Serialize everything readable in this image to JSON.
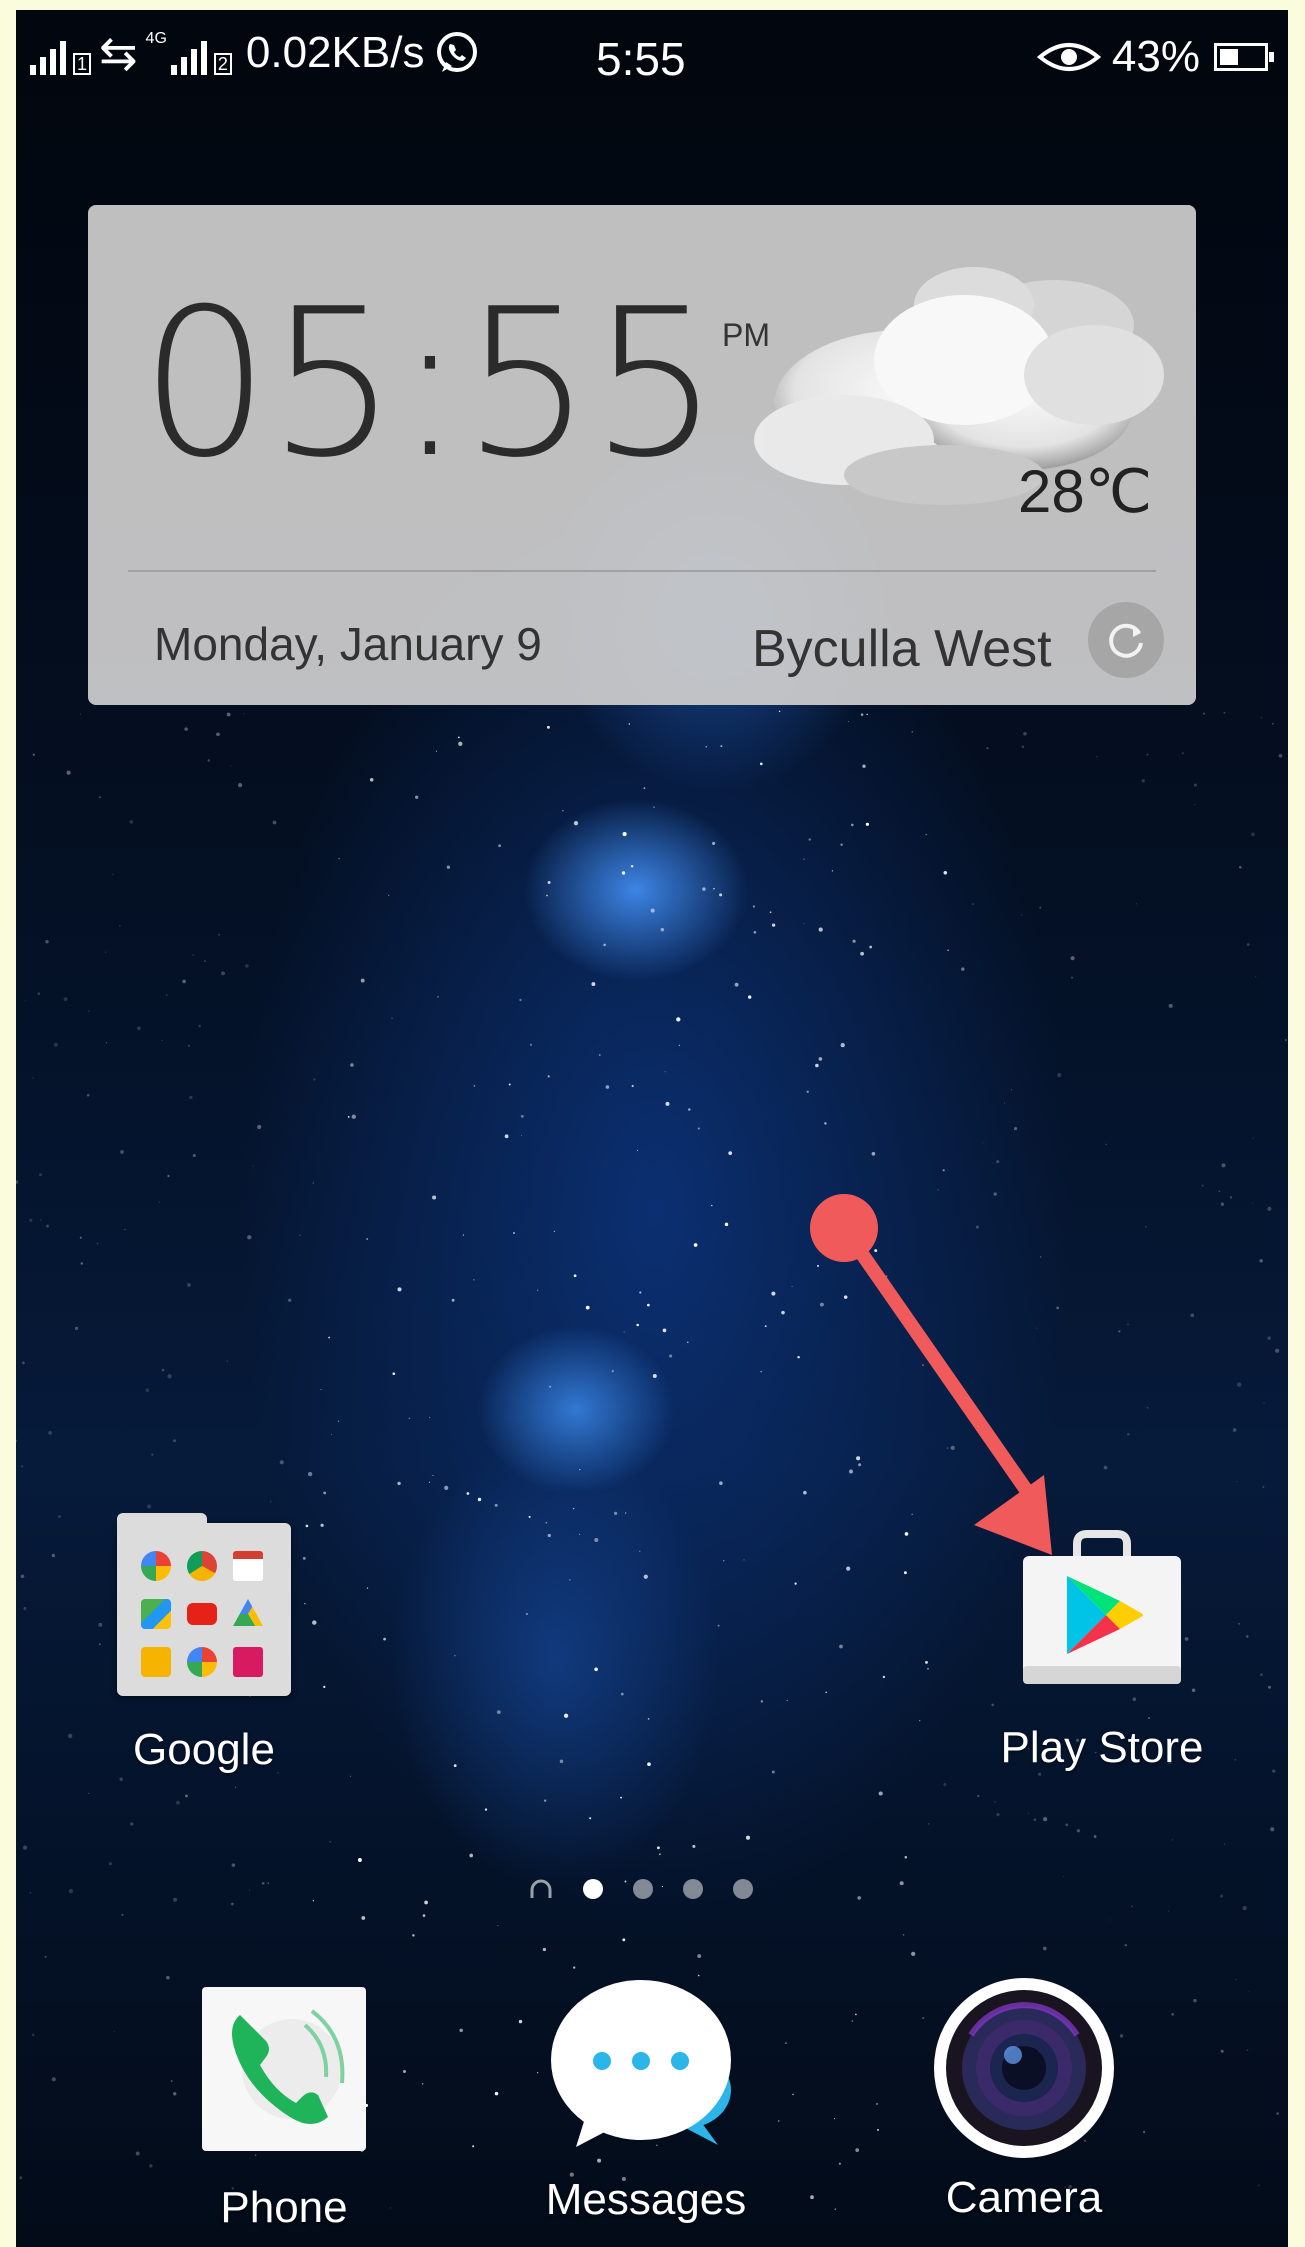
{
  "status_bar": {
    "sim1": "1",
    "sim2": "2",
    "network_type": "4G",
    "speed": "0.02KB/s",
    "time": "5:55",
    "battery": "43%",
    "battery_level": 0.43
  },
  "widget": {
    "clock": "05:55",
    "ampm": "PM",
    "temperature": "28℃",
    "date": "Monday, January 9",
    "location": "Byculla West"
  },
  "apps": [
    {
      "label": "Google",
      "icon": "google-folder-icon"
    },
    {
      "label": "Play Store",
      "icon": "play-store-icon"
    }
  ],
  "dock": [
    {
      "label": "Phone",
      "icon": "phone-icon"
    },
    {
      "label": "Messages",
      "icon": "messages-icon"
    },
    {
      "label": "Camera",
      "icon": "camera-icon"
    }
  ],
  "pages": {
    "count": 4,
    "active": 1
  },
  "annotation": {
    "color": "#f05a5a"
  }
}
